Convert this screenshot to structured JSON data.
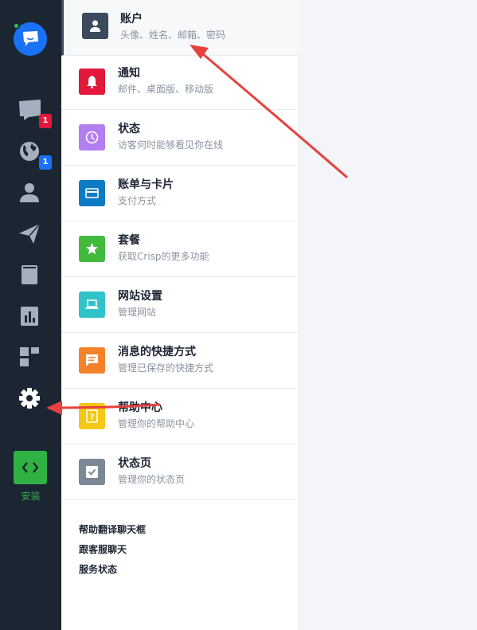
{
  "nav": {
    "badges": {
      "chat": "1",
      "visitors": "1"
    },
    "install_label": "安装"
  },
  "menu": [
    {
      "title": "账户",
      "subtitle": "头像、姓名、邮箱、密码",
      "icon": "user-icon",
      "color": "#3b4a5c"
    },
    {
      "title": "通知",
      "subtitle": "邮件、桌面版、移动版",
      "icon": "bell-icon",
      "color": "#e3183b"
    },
    {
      "title": "状态",
      "subtitle": "访客何时能够看见你在线",
      "icon": "clock-icon",
      "color": "#b37ef0"
    },
    {
      "title": "账单与卡片",
      "subtitle": "支付方式",
      "icon": "credit-card-icon",
      "color": "#0d7ac4"
    },
    {
      "title": "套餐",
      "subtitle": "获取Crisp的更多功能",
      "icon": "star-icon",
      "color": "#43b93e"
    },
    {
      "title": "网站设置",
      "subtitle": "管理网站",
      "icon": "laptop-icon",
      "color": "#30c3c9"
    },
    {
      "title": "消息的快捷方式",
      "subtitle": "管理已保存的快捷方式",
      "icon": "message-icon",
      "color": "#f4822b"
    },
    {
      "title": "帮助中心",
      "subtitle": "管理你的帮助中心",
      "icon": "help-icon",
      "color": "#f5c815"
    },
    {
      "title": "状态页",
      "subtitle": "管理你的状态页",
      "icon": "checkbox-icon",
      "color": "#7d8896"
    }
  ],
  "links": [
    "帮助翻译聊天框",
    "跟客服聊天",
    "服务状态"
  ],
  "colors": {
    "nav_bg": "#1c2633",
    "accent": "#1972f5",
    "annotation": "#e8403f"
  }
}
